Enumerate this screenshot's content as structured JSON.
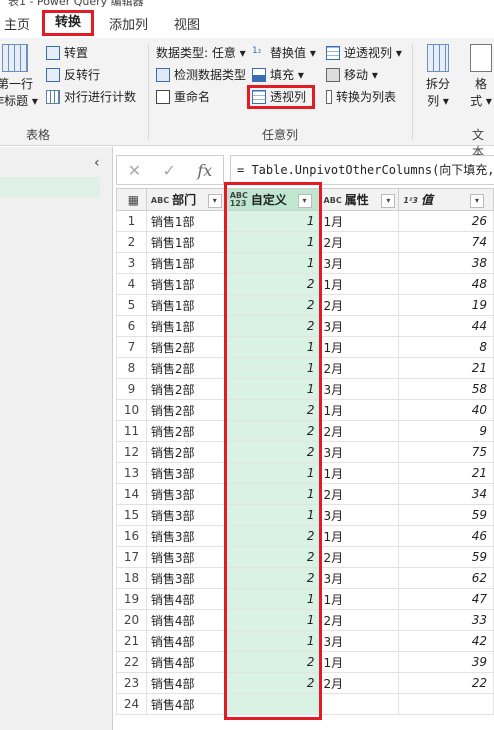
{
  "window": {
    "title": "表1 - Power Query 编辑器"
  },
  "tabs": [
    {
      "label": "主页"
    },
    {
      "label": "转换"
    },
    {
      "label": "添加列"
    },
    {
      "label": "视图"
    }
  ],
  "ribbon": {
    "table_group": {
      "label": "表格",
      "use_first_row": "第一行",
      "as_headers": "作标题",
      "transpose": "转置",
      "reverse_rows": "反转行",
      "count_rows": "对行进行计数"
    },
    "any_column_group": {
      "label": "任意列",
      "data_type": "数据类型: 任意",
      "detect_type": "检测数据类型",
      "rename": "重命名",
      "replace_values": "替换值",
      "fill": "填充",
      "pivot_column": "透视列",
      "unpivot_columns": "逆透视列",
      "move": "移动",
      "convert_to_list": "转换为列表"
    },
    "text_group": {
      "label": "文本",
      "split_col_1": "拆分",
      "split_col_2": "列",
      "format_1": "格",
      "format_2": "式"
    }
  },
  "formula_bar": {
    "cancel": "✕",
    "confirm": "✓",
    "fx": "fx",
    "formula": "= Table.UnpivotOtherColumns(向下填充, {"
  },
  "grid": {
    "columns": [
      {
        "type": "ABC",
        "type_sub": "",
        "name": "部门"
      },
      {
        "type": "ABC",
        "type_sub": "123",
        "name": "自定义"
      },
      {
        "type": "ABC",
        "type_sub": "",
        "name": "属性"
      },
      {
        "type": "1²3",
        "type_sub": "",
        "name": "值"
      }
    ],
    "rows": [
      {
        "dept": "销售1部",
        "custom": "1",
        "attr": "1月",
        "val": "26"
      },
      {
        "dept": "销售1部",
        "custom": "1",
        "attr": "2月",
        "val": "74"
      },
      {
        "dept": "销售1部",
        "custom": "1",
        "attr": "3月",
        "val": "38"
      },
      {
        "dept": "销售1部",
        "custom": "2",
        "attr": "1月",
        "val": "48"
      },
      {
        "dept": "销售1部",
        "custom": "2",
        "attr": "2月",
        "val": "19"
      },
      {
        "dept": "销售1部",
        "custom": "2",
        "attr": "3月",
        "val": "44"
      },
      {
        "dept": "销售2部",
        "custom": "1",
        "attr": "1月",
        "val": "8"
      },
      {
        "dept": "销售2部",
        "custom": "1",
        "attr": "2月",
        "val": "21"
      },
      {
        "dept": "销售2部",
        "custom": "1",
        "attr": "3月",
        "val": "58"
      },
      {
        "dept": "销售2部",
        "custom": "2",
        "attr": "1月",
        "val": "40"
      },
      {
        "dept": "销售2部",
        "custom": "2",
        "attr": "2月",
        "val": "9"
      },
      {
        "dept": "销售2部",
        "custom": "2",
        "attr": "3月",
        "val": "75"
      },
      {
        "dept": "销售3部",
        "custom": "1",
        "attr": "1月",
        "val": "21"
      },
      {
        "dept": "销售3部",
        "custom": "1",
        "attr": "2月",
        "val": "34"
      },
      {
        "dept": "销售3部",
        "custom": "1",
        "attr": "3月",
        "val": "59"
      },
      {
        "dept": "销售3部",
        "custom": "2",
        "attr": "1月",
        "val": "46"
      },
      {
        "dept": "销售3部",
        "custom": "2",
        "attr": "2月",
        "val": "59"
      },
      {
        "dept": "销售3部",
        "custom": "2",
        "attr": "3月",
        "val": "62"
      },
      {
        "dept": "销售4部",
        "custom": "1",
        "attr": "1月",
        "val": "47"
      },
      {
        "dept": "销售4部",
        "custom": "1",
        "attr": "2月",
        "val": "33"
      },
      {
        "dept": "销售4部",
        "custom": "1",
        "attr": "3月",
        "val": "42"
      },
      {
        "dept": "销售4部",
        "custom": "2",
        "attr": "1月",
        "val": "39"
      },
      {
        "dept": "销售4部",
        "custom": "2",
        "attr": "2月",
        "val": "22"
      },
      {
        "dept": "销售4部",
        "custom": "",
        "attr": "",
        "val": ""
      }
    ]
  },
  "colors": {
    "highlight": "#e21b25",
    "custom_column_fill": "#d9f2e3"
  }
}
